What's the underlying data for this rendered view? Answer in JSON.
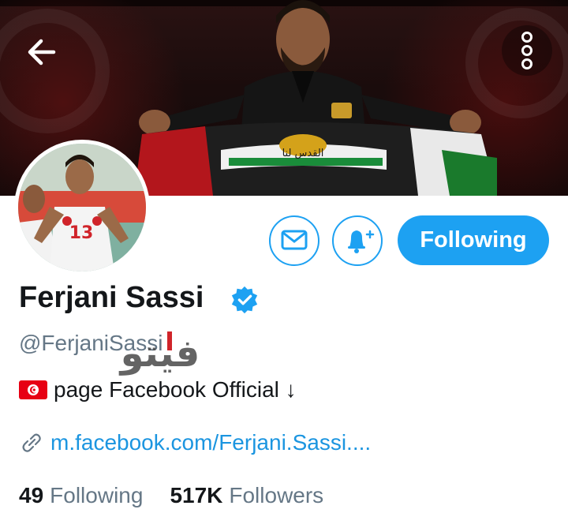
{
  "profile": {
    "name": "Ferjani Sassi",
    "handle": "@FerjaniSassi",
    "bio_text": "page Facebook Official ↓",
    "link": "m.facebook.com/Ferjani.Sassi....",
    "following_count": "49",
    "following_label": "Following",
    "followers_count": "517K",
    "followers_label": "Followers",
    "verified": true
  },
  "actions": {
    "follow_label": "Following"
  },
  "watermark": {
    "text": "فيتو"
  },
  "colors": {
    "accent": "#1da1f2",
    "link": "#1b95e0",
    "muted": "#657786",
    "text": "#14171a"
  },
  "icons": {
    "back": "arrow-left-icon",
    "more": "more-vertical-icon",
    "message": "mail-icon",
    "notify": "bell-plus-icon",
    "verified": "verified-badge-icon",
    "link": "link-icon",
    "flag": "tunisia-flag-icon"
  }
}
